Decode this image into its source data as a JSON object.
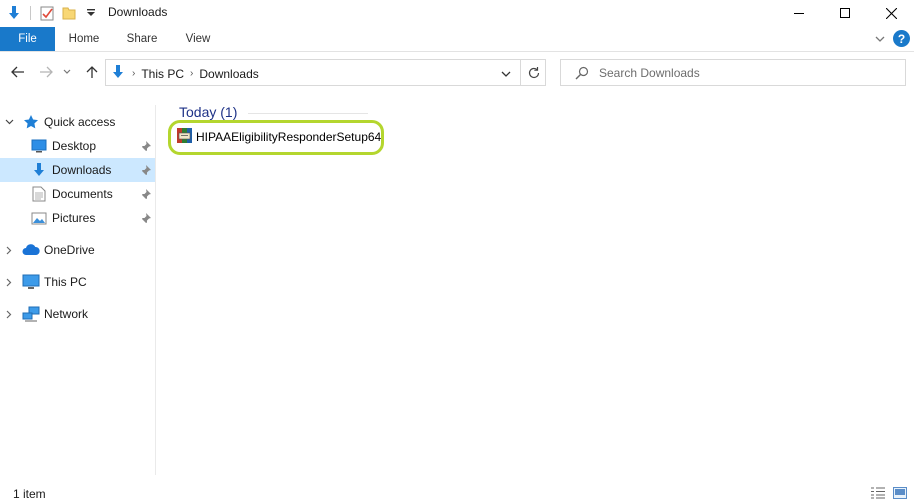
{
  "window": {
    "title": "Downloads",
    "quick_access_toolbar": [
      "down-arrow-icon",
      "properties-icon",
      "new-folder-icon",
      "customize-dropdown-icon"
    ]
  },
  "ribbon": {
    "tabs": [
      {
        "label": "File",
        "active": true
      },
      {
        "label": "Home"
      },
      {
        "label": "Share"
      },
      {
        "label": "View"
      }
    ],
    "accent_color": "#1979ca"
  },
  "address_bar": {
    "crumbs": [
      "This PC",
      "Downloads"
    ]
  },
  "search": {
    "placeholder": "Search Downloads"
  },
  "nav_pane": {
    "items": [
      {
        "label": "Quick access",
        "icon": "star-icon",
        "expanded": true,
        "level": 0
      },
      {
        "label": "Desktop",
        "icon": "desktop-icon",
        "pinned": true,
        "level": 1
      },
      {
        "label": "Downloads",
        "icon": "downloads-icon",
        "pinned": true,
        "selected": true,
        "level": 1
      },
      {
        "label": "Documents",
        "icon": "documents-icon",
        "pinned": true,
        "level": 1
      },
      {
        "label": "Pictures",
        "icon": "pictures-icon",
        "pinned": true,
        "level": 1
      },
      {
        "label": "OneDrive",
        "icon": "cloud-icon",
        "level": 0
      },
      {
        "label": "This PC",
        "icon": "computer-icon",
        "level": 0
      },
      {
        "label": "Network",
        "icon": "network-icon",
        "level": 0
      }
    ],
    "selection_color": "#cce8ff"
  },
  "content": {
    "group_header": "Today (1)",
    "files": [
      {
        "name": "HIPAAEligibilityResponderSetup64",
        "icon": "archive-installer-icon",
        "highlighted": true
      }
    ],
    "highlight_color": "#b4d62e"
  },
  "status_bar": {
    "text": "1 item"
  }
}
